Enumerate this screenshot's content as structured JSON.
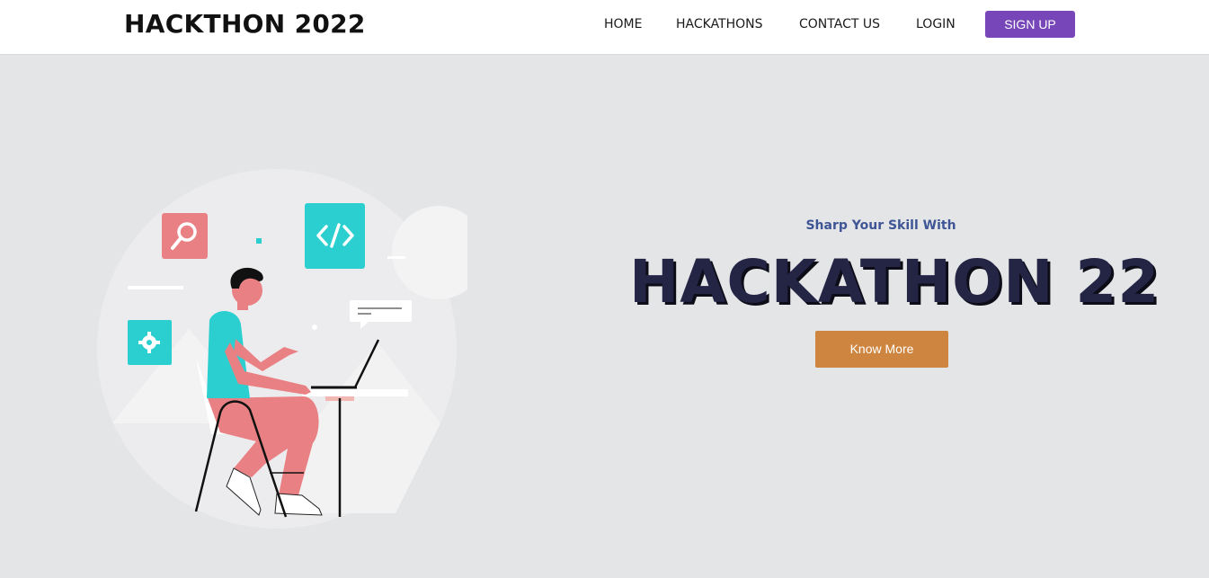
{
  "brand": {
    "title": "HACKTHON 2022"
  },
  "nav": {
    "items": [
      {
        "label": "HOME"
      },
      {
        "label": "HACKATHONS"
      },
      {
        "label": "CONTACT US"
      },
      {
        "label": "LOGIN"
      }
    ],
    "signup_label": "SIGN UP"
  },
  "hero": {
    "tagline": "Sharp Your Skill With",
    "headline": "HACKATHON 22",
    "cta_label": "Know More"
  },
  "colors": {
    "signup_bg": "#7746b8",
    "cta_bg": "#cd853f",
    "headline": "#242445",
    "tagline": "#3e5596",
    "hero_bg": "#e4e5e7"
  },
  "icons": {
    "illustration_icons": [
      "search-icon",
      "code-icon",
      "gear-icon",
      "chat-bubble-icon",
      "laptop-icon"
    ]
  }
}
